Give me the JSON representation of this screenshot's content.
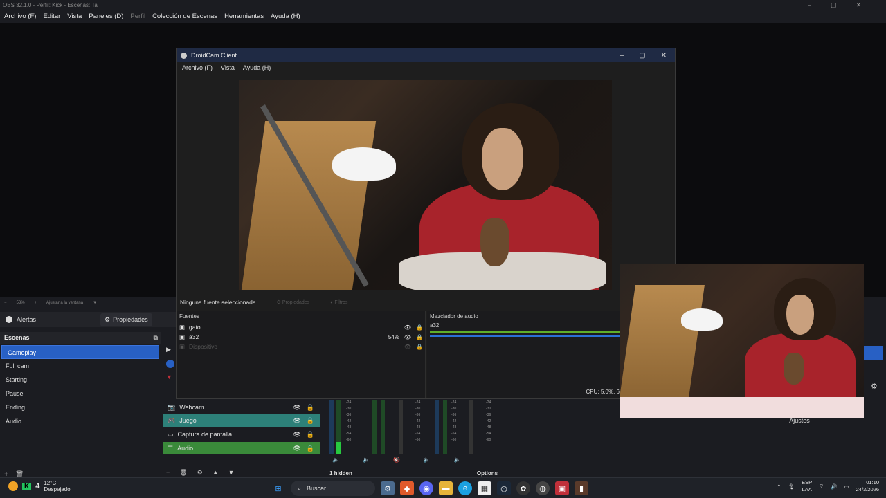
{
  "obs": {
    "title": "OBS 32.1.0 - Perfil: Kick - Escenas: Tai",
    "menu": [
      "Archivo (F)",
      "Editar",
      "Vista",
      "Paneles (D)",
      "Perfil",
      "Colección de Escenas",
      "Herramientas",
      "Ayuda (H)"
    ],
    "zoom": {
      "minus": "−",
      "value": "53%",
      "plus": "+",
      "fit": "Ajustar a la ventana"
    },
    "dock_tabs": {
      "alerts": "Alertas",
      "properties": "Propiedades"
    },
    "scenes": {
      "title": "Escenas",
      "items": [
        "Gameplay",
        "Full cam",
        "Starting",
        "Pause",
        "Ending",
        "Audio"
      ],
      "selected": "Gameplay"
    },
    "sources": [
      {
        "label": "Webcam",
        "icon": "camera-icon"
      },
      {
        "label": "Juego",
        "icon": "game-icon"
      },
      {
        "label": "Captura de pantalla",
        "icon": "monitor-icon"
      },
      {
        "label": "Audio",
        "icon": "list-icon"
      }
    ],
    "mixer_labels": [
      "-24",
      "-30",
      "-36",
      "-42",
      "-48",
      "-54",
      "-60"
    ],
    "bottom_bar": {
      "hidden": "1 hidden",
      "options": "Options"
    },
    "ajustes": "Ajustes"
  },
  "droidcam": {
    "title": "DroidCam Client",
    "menu": [
      "Archivo (F)",
      "Vista",
      "Ayuda (H)"
    ],
    "status": {
      "no_source": "Ninguna fuente seleccionada",
      "properties": "Propiedades",
      "filters": "Filtros"
    },
    "fuentes_title": "Fuentes",
    "fuentes": [
      {
        "label": "gato",
        "extra": ""
      },
      {
        "label": "a32",
        "extra": "54%"
      },
      {
        "label": "Dispositivo",
        "extra": ""
      }
    ],
    "mixer_title": "Mezclador de audio",
    "mixer_source": "a32",
    "cpu": "CPU: 5.0%, 6"
  },
  "taskbar": {
    "weather": {
      "temp": "12°C",
      "status": "Despejado",
      "badge": "4"
    },
    "search": "Buscar",
    "lang": {
      "code": "ESP",
      "region": "LAA"
    },
    "time": "01:10",
    "date": "24/3/2026"
  },
  "colors": {
    "accent": "#2860c4",
    "green": "#3a8a3a",
    "teal": "#2d8079",
    "taskbar": "#1f2228"
  }
}
